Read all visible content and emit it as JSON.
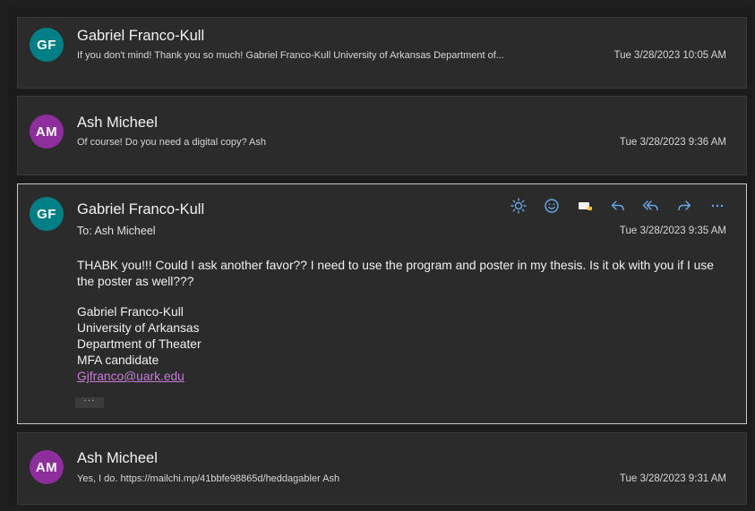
{
  "messages": [
    {
      "initials": "GF",
      "sender": "Gabriel Franco-Kull",
      "preview": "If you don't mind! Thank you so much! Gabriel Franco-Kull University of Arkansas Department of...",
      "date": "Tue 3/28/2023 10:05 AM",
      "avatar_color": "#007f86"
    },
    {
      "initials": "AM",
      "sender": "Ash Micheel",
      "preview": "Of course! Do you need a digital copy? Ash",
      "date": "Tue 3/28/2023 9:36 AM",
      "avatar_color": "#8e2d9c"
    },
    {
      "initials": "GF",
      "sender": "Gabriel Franco-Kull",
      "to_line": "To:  Ash Micheel",
      "date": "Tue 3/28/2023 9:35 AM",
      "body": "THABK you!!! Could I ask another favor?? I need to use the program and poster in my thesis. Is it ok with you if I use the poster as well???",
      "signature": {
        "name": "Gabriel Franco-Kull",
        "university": "University of Arkansas",
        "department": "Department of Theater",
        "title": "MFA candidate",
        "email": "Gjfranco@uark.edu"
      },
      "more_label": "···",
      "avatar_color": "#007f86",
      "toolbar": [
        "brightness-icon",
        "emoji-icon",
        "immersive-reader-icon",
        "reply-icon",
        "reply-all-icon",
        "forward-icon",
        "more-options-icon"
      ]
    },
    {
      "initials": "AM",
      "sender": "Ash Micheel",
      "preview": "Yes, I do. https://mailchi.mp/41bbfe98865d/heddagabler Ash",
      "date": "Tue 3/28/2023 9:31 AM",
      "avatar_color": "#8e2d9c"
    }
  ],
  "colors": {
    "accent": "#6aa8ea",
    "link": "#c77bd6"
  }
}
